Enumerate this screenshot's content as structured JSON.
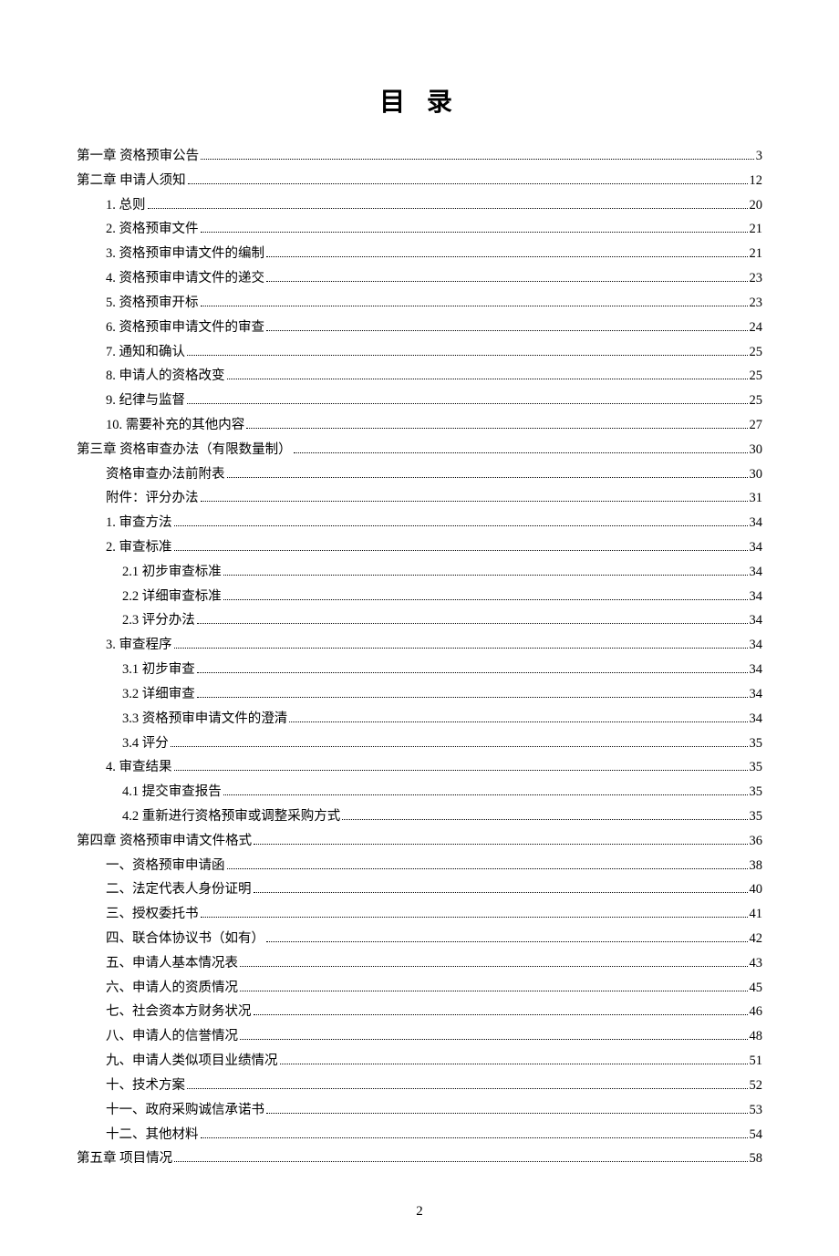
{
  "title": "目 录",
  "page_number": "2",
  "toc": [
    {
      "level": 0,
      "label": "第一章 资格预审公告",
      "page": "3"
    },
    {
      "level": 0,
      "label": "第二章 申请人须知",
      "page": "12"
    },
    {
      "level": 1,
      "label": "1. 总则",
      "page": "20"
    },
    {
      "level": 1,
      "label": "2. 资格预审文件",
      "page": "21"
    },
    {
      "level": 1,
      "label": "3. 资格预审申请文件的编制",
      "page": "21"
    },
    {
      "level": 1,
      "label": "4. 资格预审申请文件的递交",
      "page": "23"
    },
    {
      "level": 1,
      "label": "5.  资格预审开标",
      "page": "23"
    },
    {
      "level": 1,
      "label": "6. 资格预审申请文件的审查",
      "page": "24"
    },
    {
      "level": 1,
      "label": "7. 通知和确认",
      "page": "25"
    },
    {
      "level": 1,
      "label": "8. 申请人的资格改变",
      "page": "25"
    },
    {
      "level": 1,
      "label": "9. 纪律与监督",
      "page": "25"
    },
    {
      "level": 1,
      "label": "10. 需要补充的其他内容",
      "page": "27"
    },
    {
      "level": 0,
      "label": "第三章   资格审查办法（有限数量制）",
      "page": "30"
    },
    {
      "level": 1,
      "label": "资格审查办法前附表",
      "page": "30"
    },
    {
      "level": 1,
      "label": "附件：评分办法",
      "page": "31"
    },
    {
      "level": 1,
      "label": "1. 审查方法",
      "page": "34"
    },
    {
      "level": 1,
      "label": "2. 审查标准",
      "page": "34"
    },
    {
      "level": 2,
      "label": "2.1 初步审查标准",
      "page": "34"
    },
    {
      "level": 2,
      "label": "2.2 详细审查标准",
      "page": "34"
    },
    {
      "level": 2,
      "label": "2.3 评分办法",
      "page": "34"
    },
    {
      "level": 1,
      "label": "3. 审查程序",
      "page": "34"
    },
    {
      "level": 2,
      "label": "3.1 初步审查",
      "page": "34"
    },
    {
      "level": 2,
      "label": "3.2 详细审查",
      "page": "34"
    },
    {
      "level": 2,
      "label": "3.3 资格预审申请文件的澄清",
      "page": "34"
    },
    {
      "level": 2,
      "label": "3.4 评分",
      "page": "35"
    },
    {
      "level": 1,
      "label": "4. 审查结果",
      "page": "35"
    },
    {
      "level": 2,
      "label": "4.1 提交审查报告",
      "page": "35"
    },
    {
      "level": 2,
      "label": "4.2 重新进行资格预审或调整采购方式",
      "page": "35"
    },
    {
      "level": 0,
      "label": "第四章   资格预审申请文件格式",
      "page": "36"
    },
    {
      "level": 1,
      "label": "一、资格预审申请函",
      "page": "38"
    },
    {
      "level": 1,
      "label": "二、法定代表人身份证明",
      "page": "40"
    },
    {
      "level": 1,
      "label": "三、授权委托书",
      "page": "41"
    },
    {
      "level": 1,
      "label": "四、联合体协议书（如有）",
      "page": "42"
    },
    {
      "level": 1,
      "label": "五、申请人基本情况表",
      "page": "43"
    },
    {
      "level": 1,
      "label": "六、申请人的资质情况",
      "page": "45"
    },
    {
      "level": 1,
      "label": "七、社会资本方财务状况",
      "page": "46"
    },
    {
      "level": 1,
      "label": "八、申请人的信誉情况",
      "page": "48"
    },
    {
      "level": 1,
      "label": "九、申请人类似项目业绩情况",
      "page": "51"
    },
    {
      "level": 1,
      "label": "十、技术方案",
      "page": "52"
    },
    {
      "level": 1,
      "label": "十一、政府采购诚信承诺书",
      "page": "53"
    },
    {
      "level": 1,
      "label": "十二、其他材料",
      "page": "54"
    },
    {
      "level": 0,
      "label": "第五章 项目情况",
      "page": "58"
    }
  ]
}
